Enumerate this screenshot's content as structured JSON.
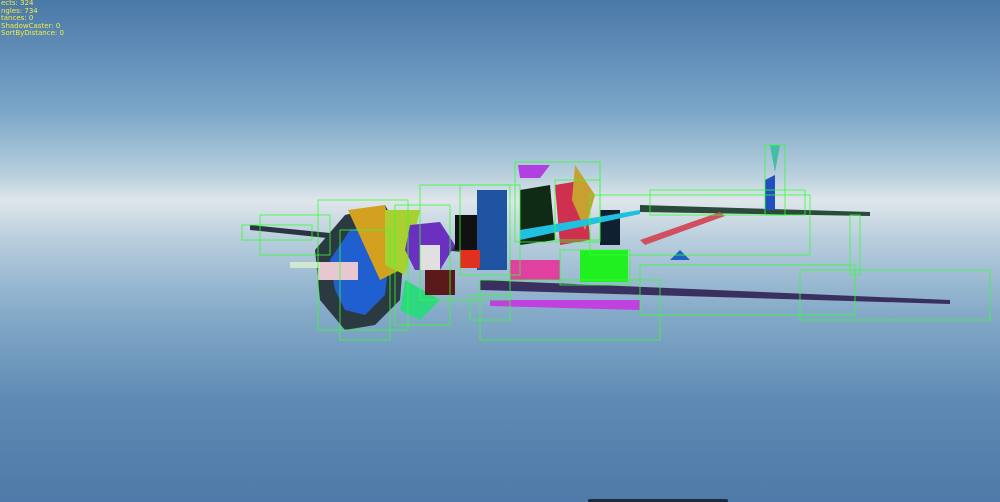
{
  "stats": [
    "ects: 324",
    "ngles: 734",
    "tances: 0",
    "ShadowCaster: 0",
    "SortByDistance: 0"
  ],
  "colors": {
    "bbox": "#33ff33",
    "text": "#e8e83a"
  }
}
